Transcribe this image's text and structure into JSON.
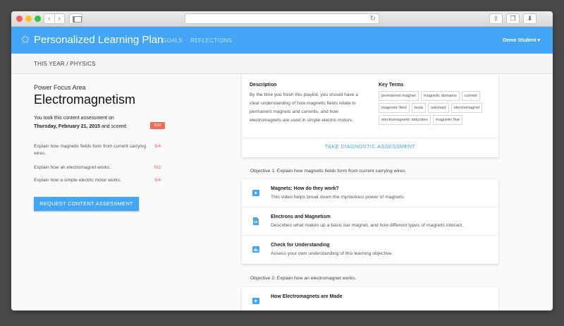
{
  "browser": {
    "back_glyph": "‹",
    "forward_glyph": "›",
    "reload_glyph": "↻"
  },
  "app": {
    "title": "Personalized Learning Plan",
    "logo_icon": "star-icon",
    "nav": {
      "goals": "GOALS",
      "reflections": "REFLECTIONS"
    },
    "user_menu": "Demo Student ▾",
    "accent": "#42a5f5"
  },
  "breadcrumb": "THIS YEAR / PHYSICS",
  "focus": {
    "label": "Power Focus Area",
    "title": "Electromagnetism",
    "assess_line1": "You took this content assessment on",
    "assess_date": "Thursday, February 21, 2015",
    "assess_line2": " and scored:",
    "score_badge": "6/10",
    "objective_scores": [
      {
        "text": "Explain how magnetic fields form from current carrying wires.",
        "score": "3/4"
      },
      {
        "text": "Explain how an electromagnet works.",
        "score": "0/2"
      },
      {
        "text": "Explain how a simple electric motor works.",
        "score": "3/4"
      }
    ],
    "request_button": "REQUEST CONTENT ASSESSMENT"
  },
  "description": {
    "title": "Description",
    "body": "By the time you finish this playlist, you should have a clear understanding of how magnetic fields relate to permanent magnets and currents, and how electromagnets are used in simple electric motors.",
    "terms_title": "Key Terms",
    "terms": [
      "permanent magnet",
      "magnetic domains",
      "current",
      "magnetic field",
      "tesla",
      "solenoid",
      "electromagnet",
      "electromagnetic induction",
      "magnetic flux"
    ],
    "diagnostic_button": "TAKE DIAGNOSTIC ASSESSMENT"
  },
  "objectives": [
    {
      "heading": "Objective 1: Explain how magnetic fields form from current carrying wires.",
      "resources": [
        {
          "icon": "video-icon",
          "title": "Magnets: How do they work?",
          "desc": "This video helps break down the mysterious power of magnets."
        },
        {
          "icon": "document-icon",
          "title": "Electrons and Magnetism",
          "desc": "Describes what makes up a basic bar magnet, and how different types of magnets interact."
        },
        {
          "icon": "chart-icon",
          "title": "Check for Understanding",
          "desc": "Assess your own understanding of this learning objective."
        }
      ]
    },
    {
      "heading": "Objective 2: Explain how an electromagnet works.",
      "resources": [
        {
          "icon": "video-icon",
          "title": "How Electromagnets are Made",
          "desc": ""
        }
      ]
    }
  ]
}
